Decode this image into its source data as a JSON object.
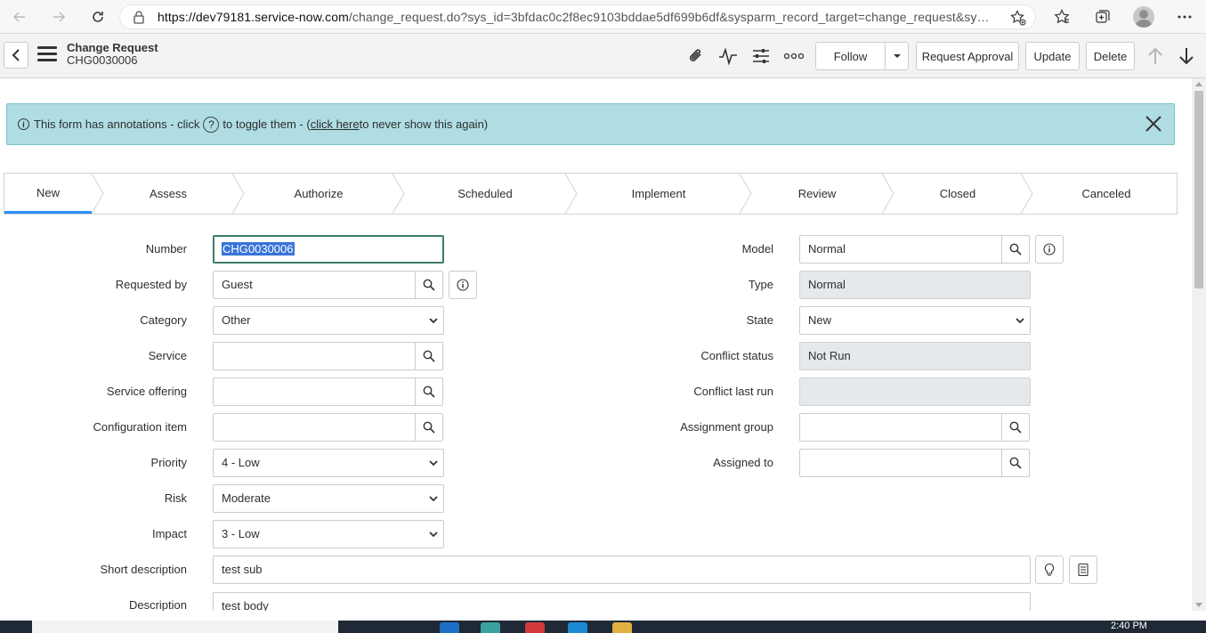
{
  "browser": {
    "url_host": "https://dev79181.service-now.com",
    "url_path": "/change_request.do?sys_id=3bfdac0c2f8ec9103bddae5df699b6df&sysparm_record_target=change_request&syspar..."
  },
  "header": {
    "title": "Change Request",
    "record_number": "CHG0030006",
    "follow_label": "Follow",
    "request_approval_label": "Request Approval",
    "update_label": "Update",
    "delete_label": "Delete"
  },
  "banner": {
    "text_before": "This form has annotations - click",
    "text_middle": "to toggle them - (",
    "link_text": "click here",
    "text_after": " to never show this again)"
  },
  "process_flow": [
    {
      "label": "New",
      "active": true
    },
    {
      "label": "Assess"
    },
    {
      "label": "Authorize"
    },
    {
      "label": "Scheduled"
    },
    {
      "label": "Implement"
    },
    {
      "label": "Review"
    },
    {
      "label": "Closed"
    },
    {
      "label": "Canceled"
    }
  ],
  "form_left": {
    "number": {
      "label": "Number",
      "value": "CHG0030006"
    },
    "requested_by": {
      "label": "Requested by",
      "value": "Guest"
    },
    "category": {
      "label": "Category",
      "value": "Other"
    },
    "service": {
      "label": "Service",
      "value": ""
    },
    "service_offering": {
      "label": "Service offering",
      "value": ""
    },
    "configuration_item": {
      "label": "Configuration item",
      "value": ""
    },
    "priority": {
      "label": "Priority",
      "value": "4 - Low"
    },
    "risk": {
      "label": "Risk",
      "value": "Moderate"
    },
    "impact": {
      "label": "Impact",
      "value": "3 - Low"
    }
  },
  "form_right": {
    "model": {
      "label": "Model",
      "value": "Normal"
    },
    "type": {
      "label": "Type",
      "value": "Normal"
    },
    "state": {
      "label": "State",
      "value": "New"
    },
    "conflict_status": {
      "label": "Conflict status",
      "value": "Not Run"
    },
    "conflict_last_run": {
      "label": "Conflict last run",
      "value": ""
    },
    "assignment_group": {
      "label": "Assignment group",
      "value": ""
    },
    "assigned_to": {
      "label": "Assigned to",
      "value": ""
    }
  },
  "form_wide": {
    "short_description": {
      "label": "Short description",
      "value": "test sub"
    },
    "description": {
      "label": "Description",
      "value": "test body"
    }
  },
  "taskbar": {
    "time": "2:40 PM"
  },
  "colors": {
    "banner_bg": "#afdde3",
    "active_step": "#278efc",
    "header_bg": "#f2f4f4",
    "readonly_bg": "#e6e9eb"
  }
}
